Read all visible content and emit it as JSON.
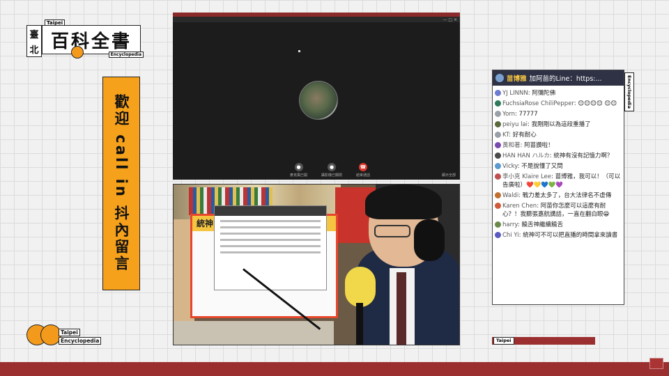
{
  "logo": {
    "top_small": "Taipei",
    "vertical": [
      "臺",
      "北"
    ],
    "main": "百科全書",
    "bottom_small": "Encyclopedia"
  },
  "banner": {
    "text": "歡迎 call in 抖內留言"
  },
  "logo2": {
    "line1": "Taipei",
    "line2": "Encyclopedia"
  },
  "meet": {
    "window_controls": "— □ ✕",
    "controls": [
      {
        "icon": "mic-icon",
        "label": "麥克風已開"
      },
      {
        "icon": "camera-off-icon",
        "label": "攝影機已關閉"
      },
      {
        "icon": "hang-up-icon",
        "label": "結束通話"
      }
    ],
    "right_label": "顯示全部"
  },
  "camera": {
    "poster_title": "統神"
  },
  "chat": {
    "pinned": {
      "name": "苗博雅",
      "text": "加阿苗的Line：https:..."
    },
    "side_tag": "Encyclopedia",
    "messages": [
      {
        "name": "YJ LINNN",
        "text": "阿彌陀佛",
        "color": "#6b7bd1"
      },
      {
        "name": "FuchsiaRose ChiliPepper",
        "text": "😊😊😊😊 😊😊",
        "color": "#2f7a5a"
      },
      {
        "name": "Yorn",
        "text": "77777",
        "color": "#9aa0a8"
      },
      {
        "name": "peiyu lai",
        "text": "我剛剛以為這段重播了",
        "color": "#5a6a3a"
      },
      {
        "name": "KT",
        "text": "好有耐心",
        "color": "#9aa0a8"
      },
      {
        "name": "黃和著",
        "text": "阿苗讚啦！",
        "color": "#7a4ab0"
      },
      {
        "name": "HAN HAN ハルカ",
        "text": "統神有沒有記憶力啊？",
        "color": "#4a4a4a"
      },
      {
        "name": "Vicky",
        "text": "不是說懂了又問",
        "color": "#5a9ad0"
      },
      {
        "name": "李小克 Klaire Lee",
        "text": "苗博雅，我可以！（可以告廣啦）❤️💛💙💚💜",
        "color": "#c05050"
      },
      {
        "name": "Waldi",
        "text": "戰力差太多了，台大法律名不虛傳",
        "color": "#c07030"
      },
      {
        "name": "Karen Chen",
        "text": "阿苗你怎麼可以這麼有耐心？！我聽張嘉航講話，一直在翻白眼😁",
        "color": "#d05a3a"
      },
      {
        "name": "harry",
        "text": "饒舌神繼續饒舌",
        "color": "#6a8a4a"
      },
      {
        "name": "Chi Yi",
        "text": "統神可不可以把直播的時間拿來讀書",
        "color": "#5a5ac0"
      }
    ]
  },
  "bottom_tag": "Taipei"
}
